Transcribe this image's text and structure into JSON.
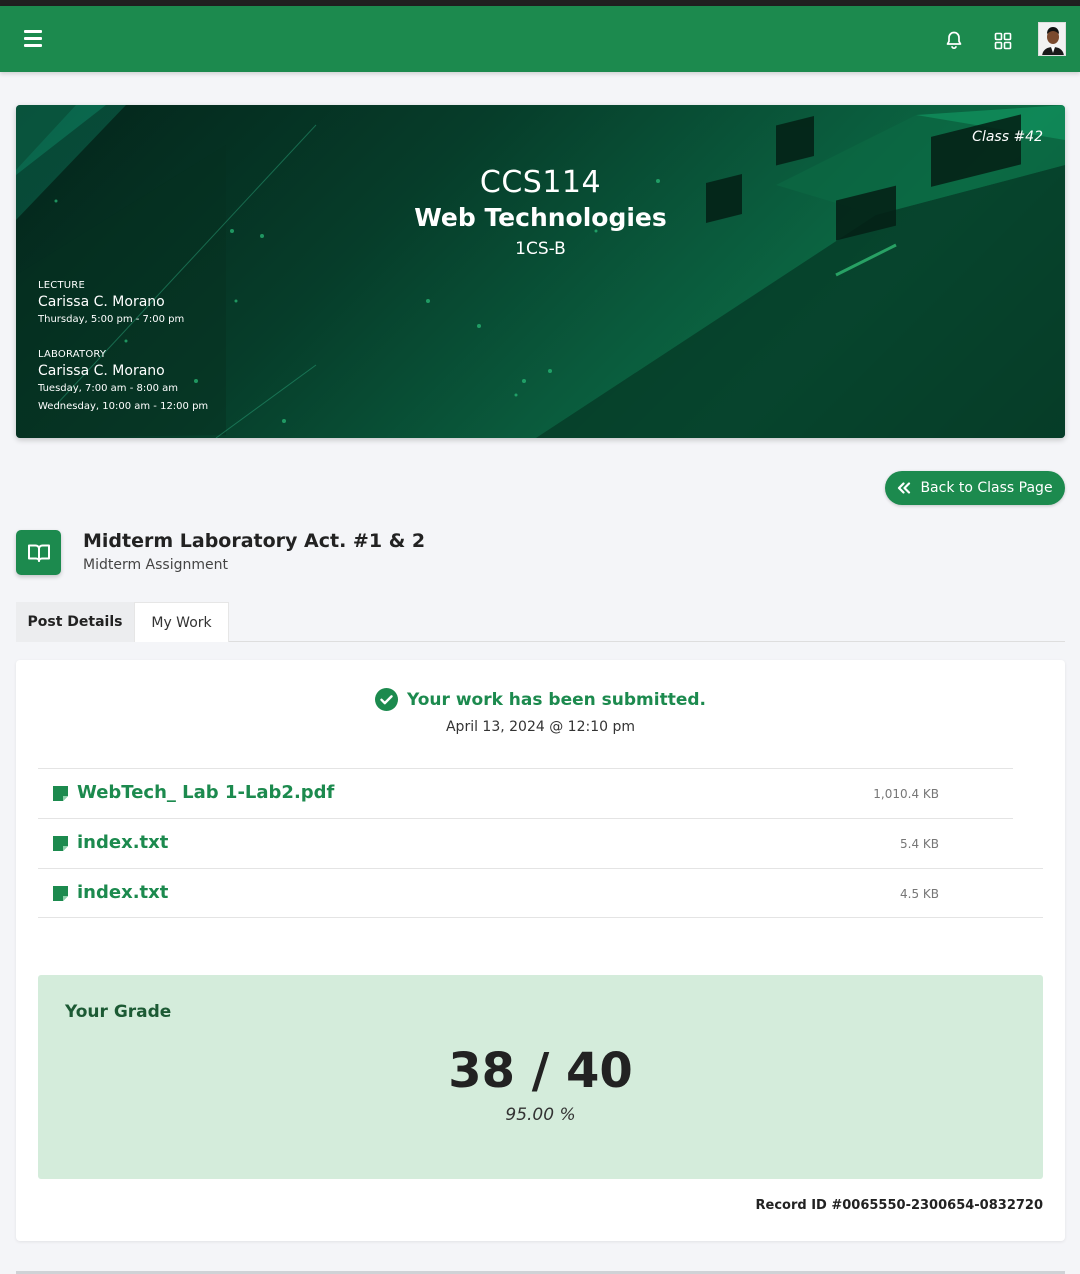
{
  "navbar": {
    "menu_icon": "hamburger-icon",
    "notification_icon": "bell-icon",
    "apps_icon": "grid-icon",
    "avatar": "user-avatar"
  },
  "banner": {
    "class_number": "Class #42",
    "course_code": "CCS114",
    "course_name": "Web Technologies",
    "section": "1CS-B",
    "lecture": {
      "label": "LECTURE",
      "instructor": "Carissa C. Morano",
      "schedule": [
        "Thursday, 5:00 pm - 7:00 pm"
      ]
    },
    "laboratory": {
      "label": "LABORATORY",
      "instructor": "Carissa C. Morano",
      "schedule": [
        "Tuesday, 7:00 am - 8:00 am",
        "Wednesday, 10:00 am - 12:00 pm"
      ]
    }
  },
  "back_button": {
    "label": "Back to Class Page",
    "icon": "double-chevron-left-icon"
  },
  "post": {
    "icon": "open-book-icon",
    "title": "Midterm Laboratory Act. #1 & 2",
    "subtitle": "Midterm Assignment"
  },
  "tabs": [
    {
      "label": "Post Details"
    },
    {
      "label": "My Work"
    }
  ],
  "submission": {
    "status": "Your work has been submitted.",
    "date": "April 13, 2024 @ 12:10 pm",
    "status_icon": "check-circle-icon"
  },
  "files": [
    {
      "name": "WebTech_ Lab 1-Lab2.pdf",
      "size": "1,010.4 KB",
      "icon": "file-icon"
    },
    {
      "name": "index.txt",
      "size": "5.4 KB",
      "icon": "file-icon"
    },
    {
      "name": "index.txt",
      "size": "4.5 KB",
      "icon": "file-icon"
    }
  ],
  "grade": {
    "label": "Your Grade",
    "score": "38 / 40",
    "percent": "95.00 %"
  },
  "record_id": "Record ID #0065550-2300654-0832720",
  "colors": {
    "primary": "#1c8a4e",
    "grade_background": "#d4ecdb",
    "page_background": "#f4f5f8"
  }
}
